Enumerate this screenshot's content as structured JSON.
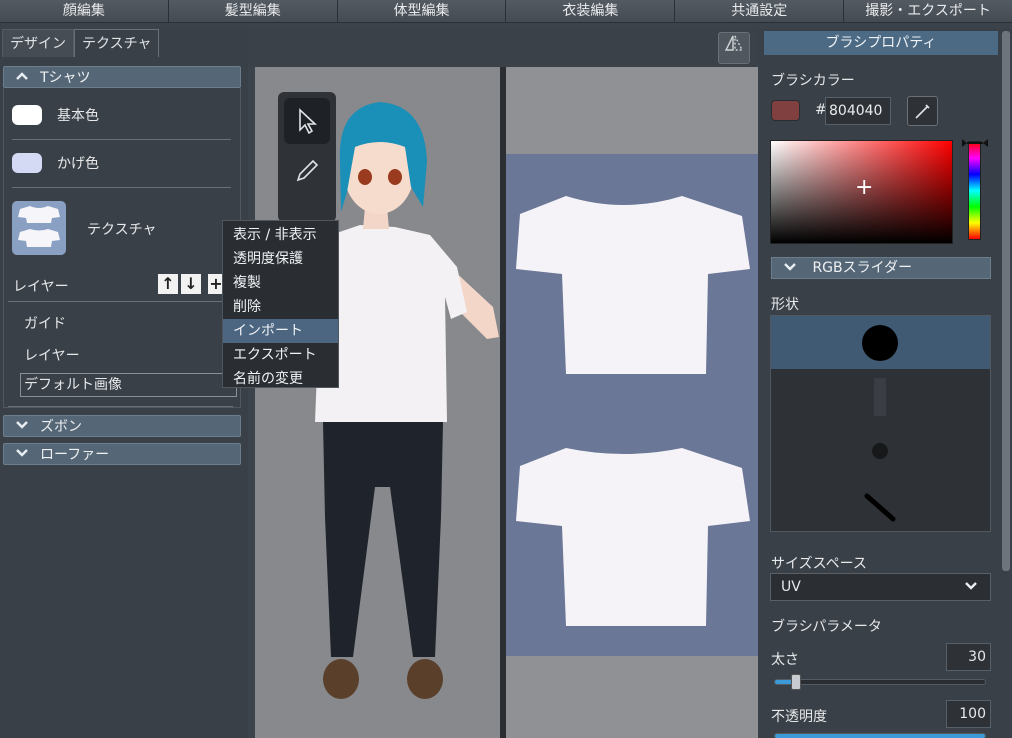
{
  "top_tabs": [
    "顔編集",
    "髪型編集",
    "体型編集",
    "衣装編集",
    "共通設定",
    "撮影・エクスポート"
  ],
  "left": {
    "subtabs": [
      "デザイン",
      "テクスチャ"
    ],
    "section_tshirt": "Tシャツ",
    "base_color_label": "基本色",
    "base_color": "#ffffff",
    "shadow_color_label": "かげ色",
    "shadow_color": "#d4daf4",
    "texture_label": "テクスチャ",
    "layer_label": "レイヤー",
    "layers": [
      "ガイド",
      "レイヤー",
      "デフォルト画像"
    ],
    "section_pants": "ズボン",
    "section_shoes": "ローファー"
  },
  "context_menu": [
    "表示 / 非表示",
    "透明度保護",
    "複製",
    "削除",
    "インポート",
    "エクスポート",
    "名前の変更"
  ],
  "context_menu_highlighted": "インポート",
  "right": {
    "header": "ブラシプロパティ",
    "brush_color_label": "ブラシカラー",
    "hex_prefix": "#",
    "hex_value": "804040",
    "brush_color": "#804040",
    "rgb_slider_label": "RGBスライダー",
    "shape_label": "形状",
    "size_space_label": "サイズスペース",
    "size_space_value": "UV",
    "brush_params_label": "ブラシパラメータ",
    "thickness_label": "太さ",
    "thickness_value": "30",
    "thickness_fraction": 0.1,
    "opacity_label": "不透明度",
    "opacity_value": "100"
  }
}
